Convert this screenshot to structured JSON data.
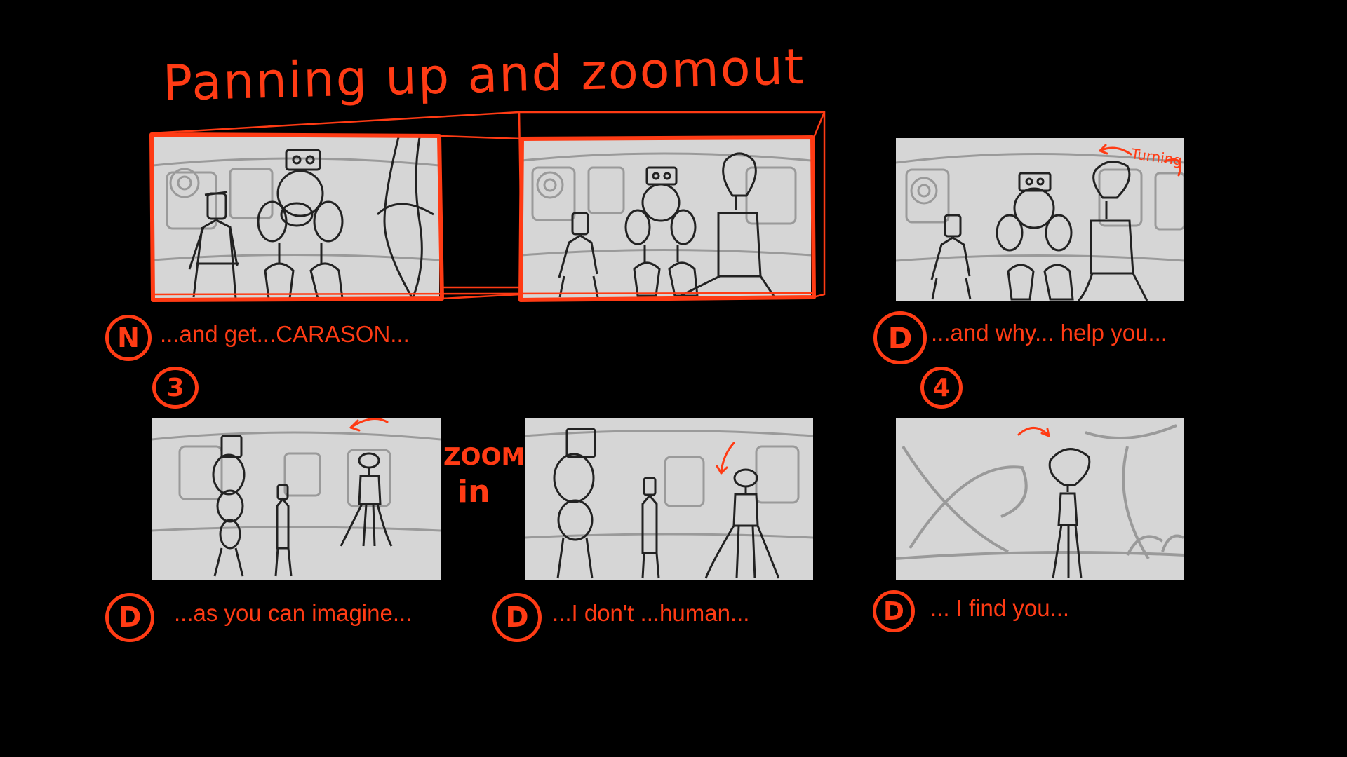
{
  "title": "Panning up and zoomout",
  "zoom_note": [
    "ZOOM",
    "in"
  ],
  "turn_note": "Turning",
  "section_numbers": {
    "three": "3",
    "four": "4"
  },
  "captions": {
    "p1": {
      "speaker": "N",
      "text": "...and get...CARASON..."
    },
    "p3": {
      "speaker": "D",
      "text": "...and why... help you..."
    },
    "p4": {
      "speaker": "D",
      "text": "...as you can imagine..."
    },
    "p5": {
      "speaker": "D",
      "text": "...I don't ...human..."
    },
    "p6": {
      "speaker": "D",
      "text": "... I find you..."
    }
  },
  "colors": {
    "background": "#000000",
    "accent": "#ff3b14",
    "panel": "#d6d6d6",
    "sketch": "#222222"
  }
}
